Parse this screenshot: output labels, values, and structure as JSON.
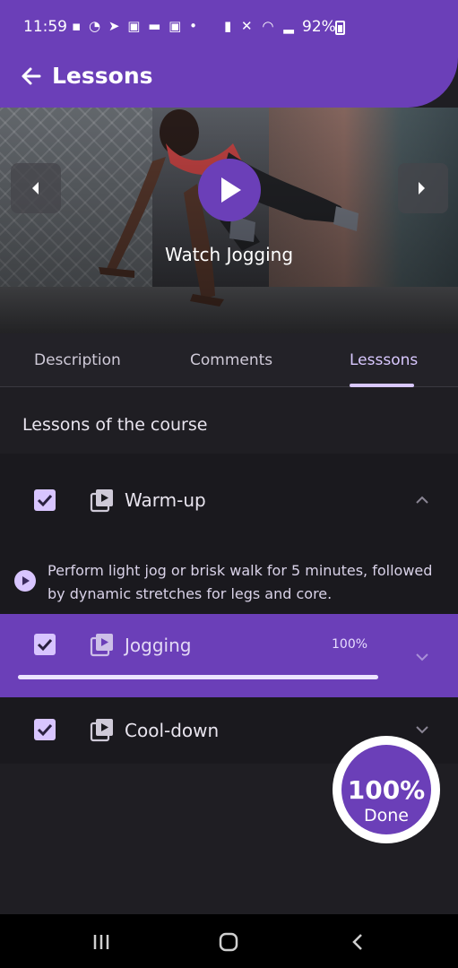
{
  "status_bar": {
    "time": "11:59",
    "left_icons": [
      "message-icon",
      "whatsapp-icon",
      "telegram-icon",
      "instagram-icon",
      "app-icon",
      "instagram-icon",
      "dot-icon"
    ],
    "right_icons": [
      "secure-icon",
      "mute-icon",
      "wifi-icon",
      "signal-icon"
    ],
    "battery": "92%"
  },
  "app_bar": {
    "title": "Lessons"
  },
  "video": {
    "caption": "Watch Jogging"
  },
  "tabs": [
    {
      "label": "Description",
      "active": false
    },
    {
      "label": "Comments",
      "active": false
    },
    {
      "label": "Lesssons",
      "active": true
    }
  ],
  "section": {
    "title": "Lessons of the course"
  },
  "lessons": [
    {
      "label": "Warm-up",
      "checked": true,
      "expanded": true,
      "description": "Perform light jog or brisk walk for 5 minutes, followed by dynamic stretches for legs and core."
    },
    {
      "label": "Jogging",
      "checked": true,
      "expanded": false,
      "active": true,
      "percent_label": "100%",
      "progress": 1.0
    },
    {
      "label": "Cool-down",
      "checked": true,
      "expanded": false
    }
  ],
  "done_badge": {
    "percent": "100%",
    "label": "Done"
  },
  "colors": {
    "primary": "#6b3fb8",
    "accent_light": "#d8c5ff",
    "background": "#1f1e23"
  }
}
